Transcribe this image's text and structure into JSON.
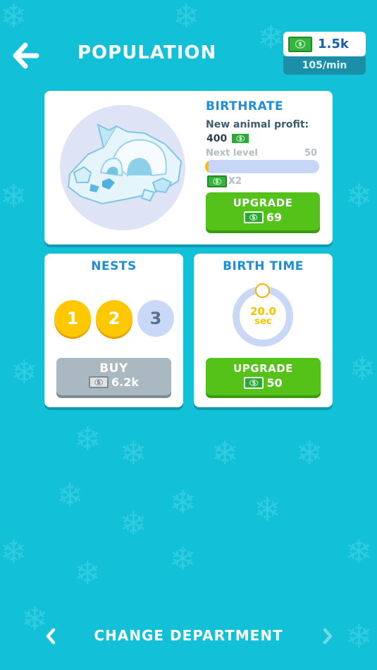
{
  "header": {
    "title": "POPULATION",
    "money": "1.5k",
    "income_rate": "105/min"
  },
  "birthrate": {
    "heading": "BIRTHRATE",
    "profit_label": "New animal profit:",
    "profit_value": "400",
    "next_level_label": "Next level",
    "next_level_value": "50",
    "progress_fraction": 0.03,
    "multiplier": "X2",
    "upgrade_label": "UPGRADE",
    "upgrade_price": "69"
  },
  "nests": {
    "heading": "NESTS",
    "items": [
      {
        "label": "1",
        "state": "active"
      },
      {
        "label": "2",
        "state": "active"
      },
      {
        "label": "3",
        "state": "locked"
      }
    ],
    "buy_label": "BUY",
    "buy_price": "6.2k"
  },
  "birth_time": {
    "heading": "BIRTH TIME",
    "value": "20.0",
    "unit": "sec",
    "upgrade_label": "UPGRADE",
    "upgrade_price": "50"
  },
  "footer": {
    "title": "CHANGE DEPARTMENT"
  },
  "colors": {
    "background": "#12c0d8",
    "accent_blue": "#1e8ed8",
    "button_green": "#55c21a",
    "button_gray": "#a9b8c1",
    "nest_gold": "#ffc800"
  },
  "icons": [
    "back-arrow-icon",
    "cash-icon",
    "igloo-icon",
    "chevron-left-icon",
    "chevron-right-icon",
    "snowflake-icon"
  ]
}
